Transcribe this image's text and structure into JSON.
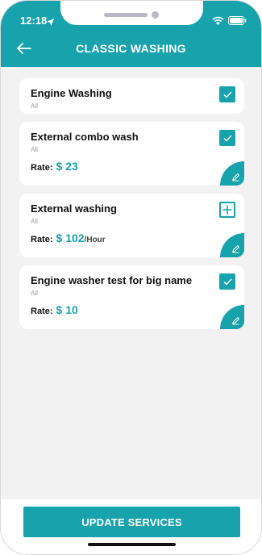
{
  "status_bar": {
    "time": "12:18"
  },
  "header": {
    "title": "CLASSIC WASHING"
  },
  "services": [
    {
      "name": "Engine Washing",
      "category": "All",
      "checked": true,
      "has_rate": false,
      "rate_label": "",
      "rate": "",
      "unit": ""
    },
    {
      "name": "External combo wash",
      "category": "All",
      "checked": true,
      "has_rate": true,
      "rate_label": "Rate:",
      "rate": "$ 23",
      "unit": ""
    },
    {
      "name": "External washing",
      "category": "All",
      "checked": false,
      "has_rate": true,
      "rate_label": "Rate:",
      "rate": "$ 102",
      "unit": "/Hour"
    },
    {
      "name": "Engine washer test for big name",
      "category": "All",
      "checked": true,
      "has_rate": true,
      "rate_label": "Rate:",
      "rate": "$ 10",
      "unit": ""
    }
  ],
  "footer": {
    "update_label": "UPDATE SERVICES"
  },
  "colors": {
    "accent": "#17a2ac",
    "background": "#f2f2f2"
  }
}
